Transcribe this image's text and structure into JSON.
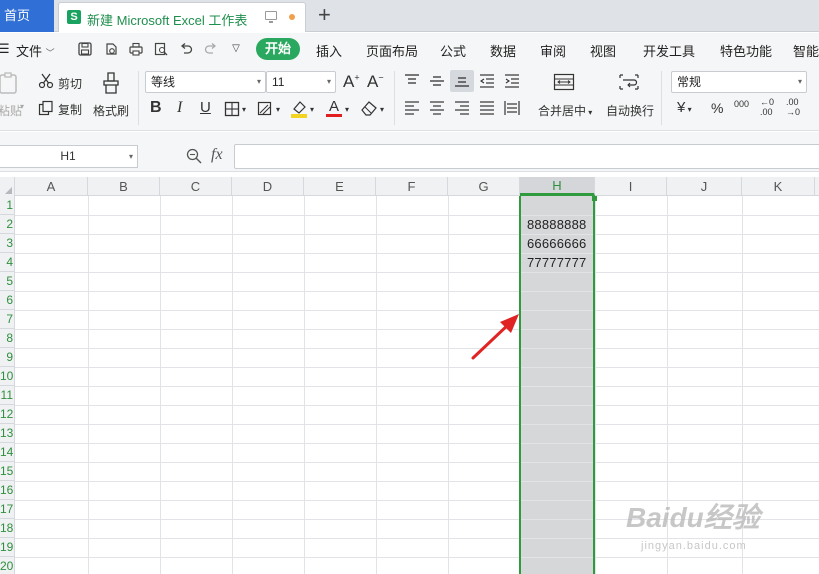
{
  "tabs": {
    "home": "首页",
    "doc_title": "新建 Microsoft Excel 工作表"
  },
  "menu": {
    "file": "文件",
    "items": [
      "开始",
      "插入",
      "页面布局",
      "公式",
      "数据",
      "审阅",
      "视图",
      "开发工具",
      "特色功能",
      "智能"
    ]
  },
  "ribbon": {
    "paste": "粘贴",
    "cut": "剪切",
    "copy": "复制",
    "format_painter": "格式刷",
    "font_name": "等线",
    "font_size": "11",
    "merge_center": "合并居中",
    "wrap_text": "自动换行",
    "number_format": "常规",
    "currency_symbol": "¥",
    "percent_symbol": "%",
    "thousands": "000"
  },
  "formula_bar": {
    "name_box": "H1",
    "fx": "fx",
    "formula": ""
  },
  "grid": {
    "columns": [
      "A",
      "B",
      "C",
      "D",
      "E",
      "F",
      "G",
      "H",
      "I",
      "J",
      "K"
    ],
    "selected_column": "H",
    "rows": [
      "1",
      "2",
      "3",
      "4",
      "5",
      "6",
      "7",
      "8",
      "9",
      "10",
      "11",
      "12",
      "13",
      "14",
      "15",
      "16",
      "17",
      "18",
      "19",
      "20"
    ],
    "cells": {
      "H2": "88888888",
      "H3": "66666666",
      "H4": "77777777"
    }
  },
  "watermark": {
    "main": "Baidu经验",
    "sub": "jingyan.baidu.com"
  }
}
